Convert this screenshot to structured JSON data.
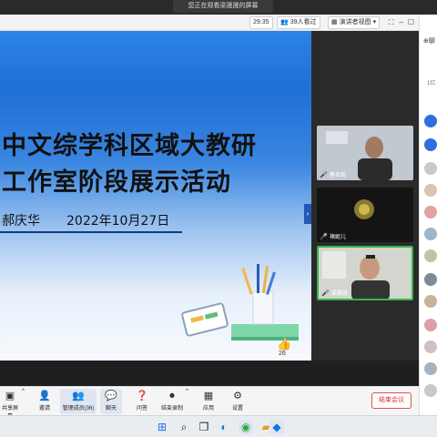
{
  "notice": "您正在观看梁晟晟的屏幕",
  "top_toolbar": {
    "timer": "29:35",
    "viewers": "39人看过",
    "view_mode": "演讲者视图"
  },
  "right_panel": {
    "header_label": "聊",
    "count_label": "1亿"
  },
  "slide": {
    "title_line1": "中文综学科区域大教研",
    "title_line2": "工作室阶段展示活动",
    "author": "郝庆华",
    "date": "2022年10月27日",
    "like_count": "26"
  },
  "videos": [
    {
      "name": "教体局",
      "speaking": false
    },
    {
      "name": "褚妮儿",
      "speaking": false
    },
    {
      "name": "梁晟晟",
      "speaking": true
    }
  ],
  "bottom_toolbar": {
    "share": "共享屏幕",
    "invite": "邀请",
    "members": "管理成员(36)",
    "chat": "聊天",
    "qa": "问答",
    "record": "结束录制",
    "apps": "应用",
    "settings": "设置",
    "end_meeting": "结束会议"
  },
  "colors": {
    "accent_blue": "#2d83e6",
    "active_speaker": "#3bb54a",
    "end_red": "#e03030"
  }
}
